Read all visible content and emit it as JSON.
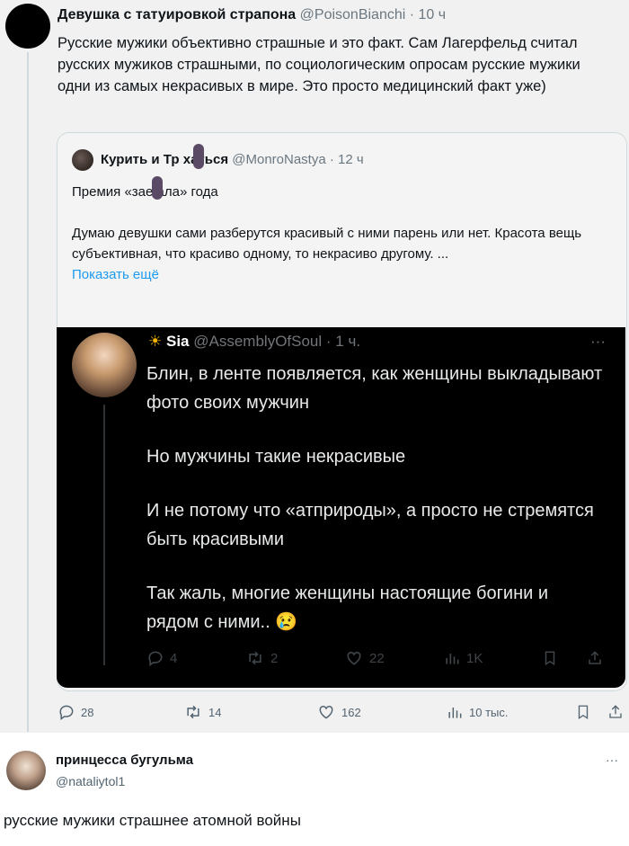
{
  "main_tweet": {
    "author_name": "Девушка с татуировкой страпона",
    "handle": "@PoisonBianchi",
    "time": "· 10 ч",
    "text": "Русские мужики объективно страшные и это факт. Сам Лагерфельд считал русских мужиков страшными, по социологическим опросам русские мужики одни из самых некрасивых в мире. Это просто медицинский факт уже)",
    "actions": {
      "replies": "28",
      "retweets": "14",
      "likes": "162",
      "views": "10 тыс."
    }
  },
  "quoted_tweet": {
    "author_name": "Курить и Тр хаться",
    "handle": "@MonroNastya",
    "time": "· 12 ч",
    "line1": "Премия «зае ала» года",
    "line2": "Думаю девушки сами разберутся красивый с ними парень или нет. Красота вещь субъективная, что красиво одному, то некрасиво другому. ...",
    "show_more": "Показать ещё"
  },
  "inner_tweet": {
    "author_name": "Sia",
    "handle": "@AssemblyOfSoul",
    "time": "· 1 ч.",
    "paragraphs": [
      "Блин, в ленте появляется, как женщины выкладывают фото своих мужчин",
      "Но мужчины такие некрасивые",
      "И не потому что «атприроды», а просто не стремятся быть красивыми",
      "Так жаль, многие женщины настоящие богини и рядом с ними.. 😢"
    ],
    "actions": {
      "replies": "4",
      "retweets": "2",
      "likes": "22",
      "views": "1K"
    }
  },
  "reply_tweet": {
    "author_name": "принцесса бугульма",
    "handle": "@nataliytol1",
    "text": "русские мужики страшнее атомной войны"
  },
  "icons": [
    "reply-icon",
    "retweet-icon",
    "like-icon",
    "views-icon",
    "bookmark-icon",
    "share-icon",
    "more-icon",
    "sun-icon"
  ]
}
